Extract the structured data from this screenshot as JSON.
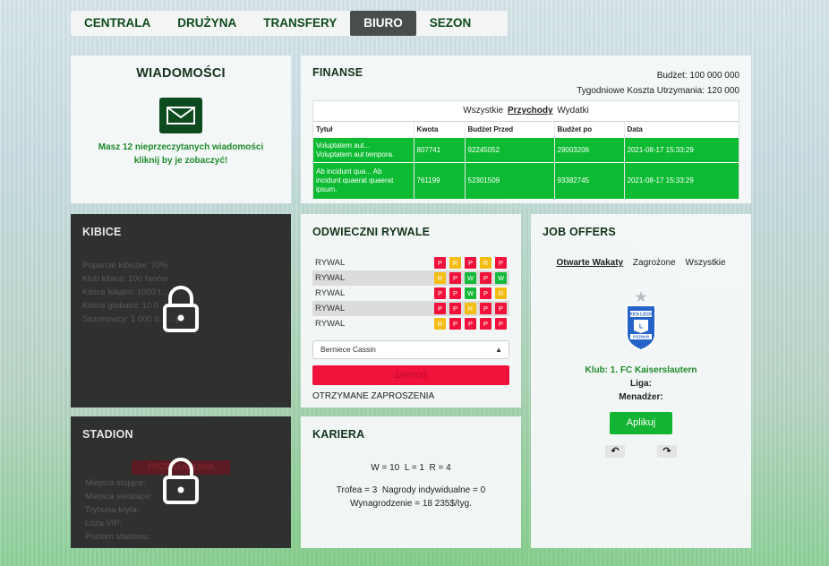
{
  "nav": {
    "items": [
      "CENTRALA",
      "DRUŻYNA",
      "TRANSFERY",
      "BIURO",
      "SEZON"
    ],
    "active": "BIURO"
  },
  "messages": {
    "title": "WIADOMOŚCI",
    "icon": "envelope-icon",
    "text_prefix": "Masz",
    "count": "12",
    "text_suffix": "nieprzeczytanych wiadomości",
    "text_line2": "kliknij by je zobaczyć!"
  },
  "finance": {
    "title": "FINANSE",
    "budget": "Budżet: 100 000 000",
    "weekly_costs": "Tygodniowe Koszta Utrzymania: 120 000",
    "filter": {
      "all": "Wszystkie",
      "income": "Przychody",
      "expenses": "Wydatki",
      "selected": "Przychody"
    },
    "columns": [
      "Tytuł",
      "Kwota",
      "Budżet Przed",
      "Budżet po",
      "Data"
    ],
    "rows": [
      {
        "title_line1": "Voluptatem aut...",
        "title_line2": "Voluptatem aut tempora.",
        "title_line3": "",
        "amount": "807741",
        "before": "92245052",
        "after": "29003206",
        "date": "2021-08-17 15:33:29"
      },
      {
        "title_line1": "Ab incidunt qua... Ab",
        "title_line2": "incidunt quaerat quaerat",
        "title_line3": "ipsum.",
        "amount": "761199",
        "before": "52301509",
        "after": "93382745",
        "date": "2021-08-17 15:33:29"
      }
    ]
  },
  "fans": {
    "title": "KIBICE",
    "locked": true,
    "lines": [
      "Poparcie kibiców: 70%",
      "Klub kibica: 100 fanów",
      "Kibice lokalni: 1000 f...",
      "Kibice globalni: 10 0... ...",
      "Sezonowcy: 1 000 0... ...y"
    ]
  },
  "stadium": {
    "title": "STADION",
    "locked": true,
    "badge": "PRZEGLĄDOWA",
    "lines": [
      "Miejsca stojące:",
      "Miejsca siedzące:",
      "Trybuna kryta:",
      "Loża VIP:",
      "Poziom stadionu:"
    ]
  },
  "rivals": {
    "title": "ODWIECZNI RYWALE",
    "rows": [
      {
        "name": "RYWAL",
        "form": [
          "P",
          "R",
          "P",
          "R",
          "P"
        ]
      },
      {
        "name": "RYWAL",
        "form": [
          "R",
          "P",
          "W",
          "P",
          "W"
        ]
      },
      {
        "name": "RYWAL",
        "form": [
          "P",
          "P",
          "W",
          "P",
          "R"
        ]
      },
      {
        "name": "RYWAL",
        "form": [
          "P",
          "P",
          "R",
          "P",
          "P"
        ]
      },
      {
        "name": "RYWAL",
        "form": [
          "R",
          "P",
          "P",
          "P",
          "P"
        ]
      }
    ],
    "select_value": "Berniece Cassin",
    "invite_button": "ZAPROŚ",
    "received_label": "OTRZYMANE ZAPROSZENIA",
    "colors": {
      "P": "#f0123b",
      "R": "#f3bd14",
      "W": "#14b93a"
    }
  },
  "career": {
    "title": "KARIERA",
    "w": "W = 10",
    "l": "L = 1",
    "r": "R = 4",
    "trophies": "Trofea = 3",
    "awards": "Nagrody indywidualne = 0",
    "salary": "Wynagrodzenie = 18 235$/tyg."
  },
  "jobs": {
    "title": "JOB OFFERS",
    "tabs": [
      "Otwarte Wakaty",
      "Zagrożone",
      "Wszystkie"
    ],
    "selected_tab": "Otwarte Wakaty",
    "crest_text": "KKS LECH POZNAŃ",
    "club_label": "Klub:",
    "club_value": "1. FC Kaiserslautern",
    "league_label": "Liga:",
    "league_value": "",
    "manager_label": "Menadżer:",
    "manager_value": "",
    "apply_button": "Aplikuj",
    "prev_icon": "undo-arrow-icon",
    "next_icon": "redo-arrow-icon"
  }
}
